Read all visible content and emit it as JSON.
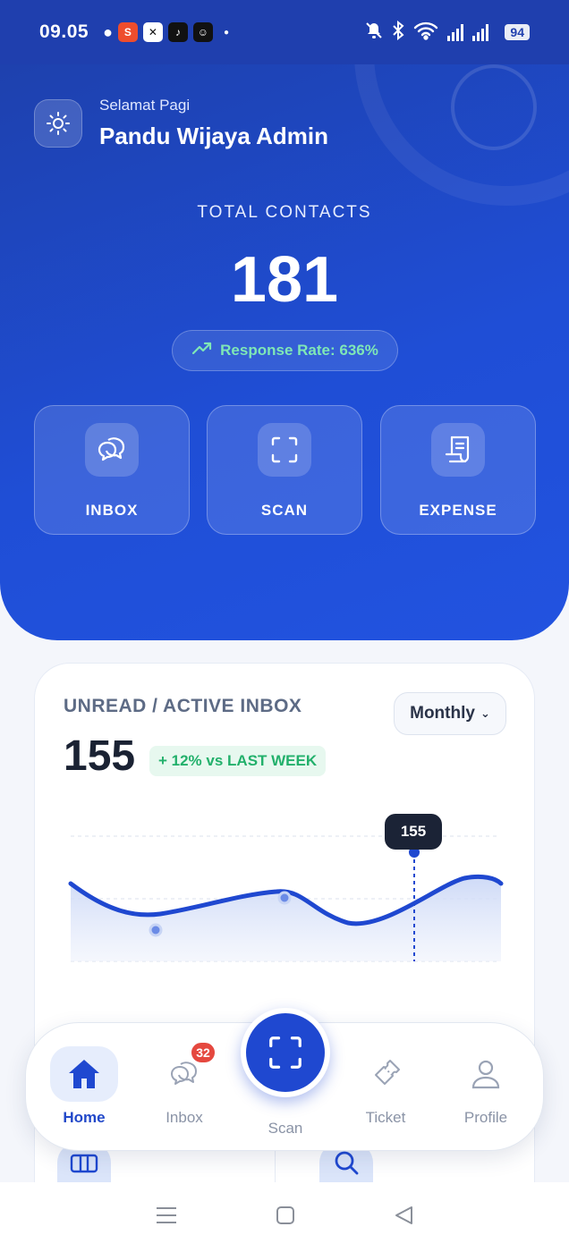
{
  "status_bar": {
    "time": "09.05",
    "battery": "94",
    "apps": [
      "chat-icon",
      "shopee-icon",
      "capcut-icon",
      "tiktok-icon",
      "smile-app-icon"
    ]
  },
  "header": {
    "greeting": "Selamat Pagi",
    "user_name": "Pandu Wijaya Admin",
    "total_label": "TOTAL CONTACTS",
    "total_value": "181",
    "response_rate": "Response Rate: 636%"
  },
  "actions": [
    {
      "label": "INBOX",
      "icon": "chat-bubbles-icon"
    },
    {
      "label": "SCAN",
      "icon": "scan-frame-icon"
    },
    {
      "label": "EXPENSE",
      "icon": "receipt-icon"
    }
  ],
  "inbox_card": {
    "title": "UNREAD / ACTIVE INBOX",
    "period": "Monthly",
    "value": "155",
    "trend": "+ 12% vs LAST WEEK",
    "tooltip": "155"
  },
  "nav": {
    "items": [
      {
        "label": "Home",
        "icon": "home-icon",
        "active": true
      },
      {
        "label": "Inbox",
        "icon": "chat-icon",
        "badge": "32"
      },
      {
        "label": "Scan",
        "icon": "scan-icon"
      },
      {
        "label": "Ticket",
        "icon": "ticket-icon"
      },
      {
        "label": "Profile",
        "icon": "user-icon"
      }
    ]
  },
  "colors": {
    "primary": "#1f48d0",
    "success": "#22b06b",
    "badge": "#e5483f"
  }
}
